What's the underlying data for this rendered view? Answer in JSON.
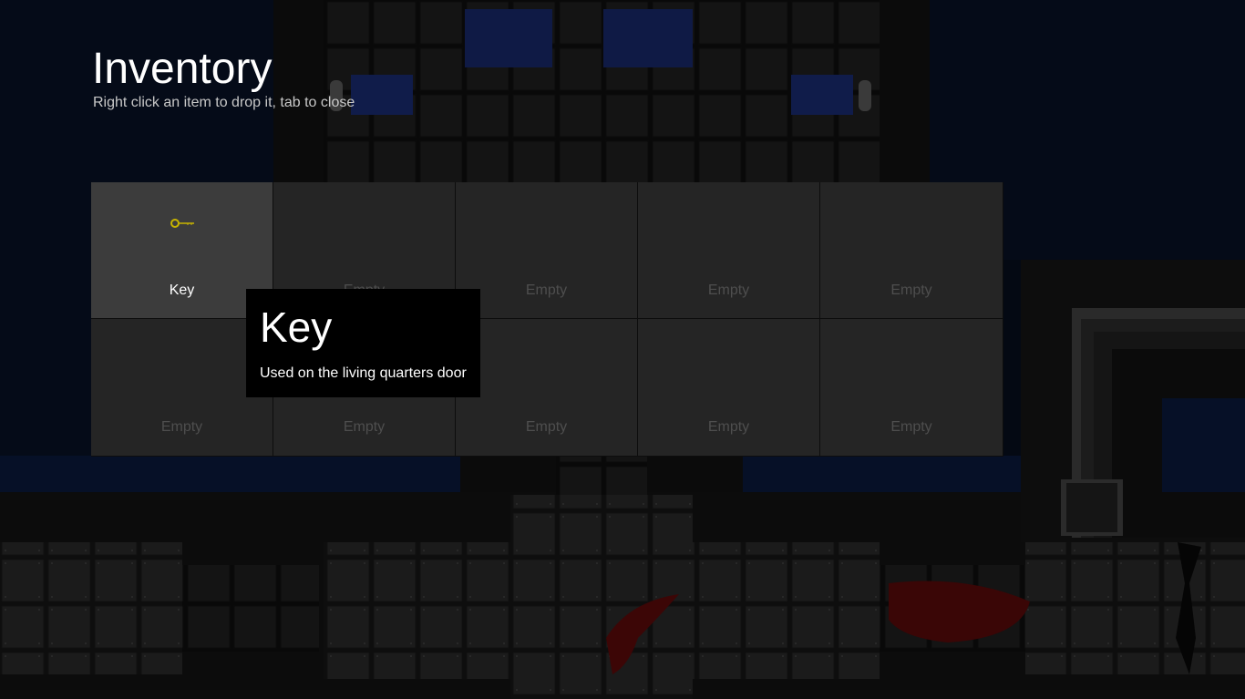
{
  "header": {
    "title": "Inventory",
    "subtitle": "Right click an item to drop it, tab to close"
  },
  "inventory": {
    "slots": [
      {
        "label": "Key",
        "icon": "key-icon",
        "filled": true
      },
      {
        "label": "Empty",
        "filled": false
      },
      {
        "label": "Empty",
        "filled": false
      },
      {
        "label": "Empty",
        "filled": false
      },
      {
        "label": "Empty",
        "filled": false
      },
      {
        "label": "Empty",
        "filled": false
      },
      {
        "label": "Empty",
        "filled": false
      },
      {
        "label": "Empty",
        "filled": false
      },
      {
        "label": "Empty",
        "filled": false
      },
      {
        "label": "Empty",
        "filled": false
      }
    ]
  },
  "tooltip": {
    "title": "Key",
    "description": "Used on the living quarters door"
  },
  "colors": {
    "key_icon": "#c8b400",
    "blood": "#5a0a0a",
    "water": "#0a1636"
  }
}
